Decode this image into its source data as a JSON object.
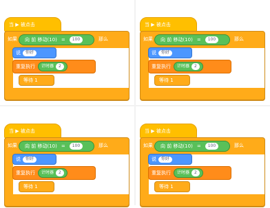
{
  "panels": [
    {
      "event": "当 ▶ 被点击",
      "if": "如果",
      "cond_left": "向 前 移动(10)",
      "cond_op": "=",
      "cond_val": "100",
      "then": "那么",
      "looks_label": "说",
      "looks_val": "你好",
      "ctrl_label": "重复执行",
      "op_left": "计时器",
      "op_val": "2",
      "say": "等待 1"
    },
    {
      "event": "当 ▶ 被点击",
      "if": "如果",
      "cond_left": "向 前 移动(10)",
      "cond_op": "=",
      "cond_val": "100",
      "then": "那么",
      "looks_label": "说",
      "looks_val": "你好",
      "ctrl_label": "重复执行",
      "op_left": "计时器",
      "op_val": "2",
      "say": "等待 1"
    },
    {
      "event": "当 ▶ 被点击",
      "if": "如果",
      "cond_left": "向 前 移动(10)",
      "cond_op": "=",
      "cond_val": "100",
      "then": "那么",
      "looks_label": "说",
      "looks_val": "你好",
      "ctrl_label": "重复执行",
      "op_left": "计时器",
      "op_val": "2",
      "say": "等待 1"
    },
    {
      "event": "当 ▶ 被点击",
      "if": "如果",
      "cond_left": "向 前 移动(10)",
      "cond_op": "=",
      "cond_val": "100",
      "then": "那么",
      "looks_label": "说",
      "looks_val": "你好",
      "ctrl_label": "重复执行",
      "op_left": "计时器",
      "op_val": "2",
      "say": "等待 1"
    }
  ]
}
